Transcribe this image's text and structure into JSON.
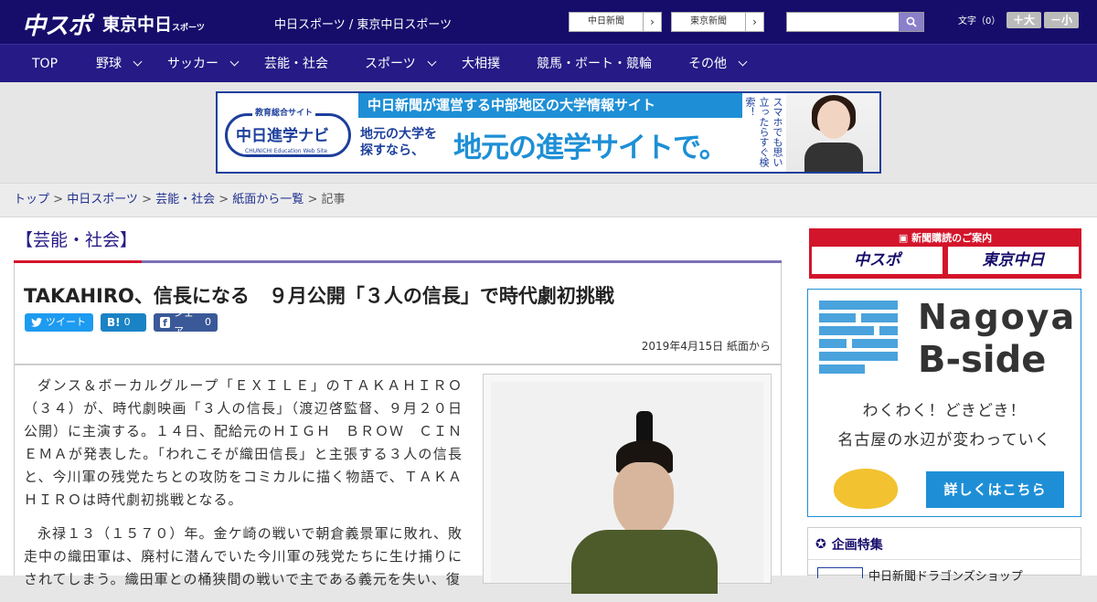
{
  "header": {
    "logo_chuspo": "中スポ",
    "logo_tokyo": "東京中日",
    "logo_tokyo_small": "スポーツ",
    "site_name": "中日スポーツ / 東京中日スポーツ",
    "paper_links": [
      {
        "label": "中日新聞"
      },
      {
        "label": "東京新聞"
      }
    ],
    "search": {
      "placeholder": ""
    },
    "font_size_label": "文字（0）",
    "font_bigger": "＋大",
    "font_smaller": "－小"
  },
  "nav": {
    "items": [
      {
        "label": "TOP",
        "dropdown": false
      },
      {
        "label": "野球",
        "dropdown": true
      },
      {
        "label": "サッカー",
        "dropdown": true
      },
      {
        "label": "芸能・社会",
        "dropdown": false
      },
      {
        "label": "スポーツ",
        "dropdown": true
      },
      {
        "label": "大相撲",
        "dropdown": false
      },
      {
        "label": "競馬・ボート・競輪",
        "dropdown": false
      },
      {
        "label": "その他",
        "dropdown": true
      }
    ]
  },
  "banner": {
    "logo_tag": "教育総合サイト",
    "logo_name": "中日進学ナビ",
    "logo_en": "CHUNICHI Education Web Site",
    "headline": "中日新聞が運営する中部地区の大学情報サイト",
    "sub_line1": "地元の大学を",
    "sub_line2": "探すなら、",
    "big": "地元の進学サイトで。",
    "vertical": "スマホでも思い立ったらすぐ検索！"
  },
  "breadcrumb": {
    "items": [
      "トップ",
      "中日スポーツ",
      "芸能・社会",
      "紙面から一覧"
    ],
    "current": "記事",
    "sep": " > "
  },
  "article": {
    "category": "【芸能・社会】",
    "title": "TAKAHIRO、信長になる　９月公開「３人の信長」で時代劇初挑戦",
    "share": {
      "tweet": "ツイート",
      "hatena_count": "0",
      "fb_share": "シェア",
      "fb_count": "0",
      "hatena": "B!"
    },
    "date": "2019年4月15日 紙面から",
    "paragraphs": [
      "ダンス＆ボーカルグループ「ＥＸＩＬＥ」のＴＡＫＡＨＩＲＯ（３４）が、時代劇映画「３人の信長」（渡辺啓監督、９月２０日公開）に主演する。１４日、配給元のＨＩＧＨ　ＢＲＯＷ　ＣＩＮＥＭＡが発表した。「われこそが織田信長」と主張する３人の信長と、今川軍の残党たちとの攻防をコミカルに描く物語で、ＴＡＫＡＨＩＲＯは時代劇初挑戦となる。",
      "永禄１３（１５７０）年。金ケ崎の戦いで朝倉義景軍に敗れ、敗走中の織田軍は、廃村に潜んでいた今川軍の残党たちに生け捕りにされてしまう。織田軍との桶狭間の戦いで主である義元を失い、復"
    ]
  },
  "sidebar": {
    "subscribe_label": "新聞購読のご案内",
    "subscribe_chuspo": "中スポ",
    "subscribe_tokyo": "東京中日",
    "ad_title1": "Nagoya",
    "ad_title2": "B-side",
    "ad_copy1": "わくわく！どきどき！",
    "ad_copy2": "名古屋の水辺が変わっていく",
    "ad_cta": "詳しくはこちら",
    "feature_heading": "企画特集",
    "feature_item": "中日新聞ドラゴンズショップ"
  }
}
